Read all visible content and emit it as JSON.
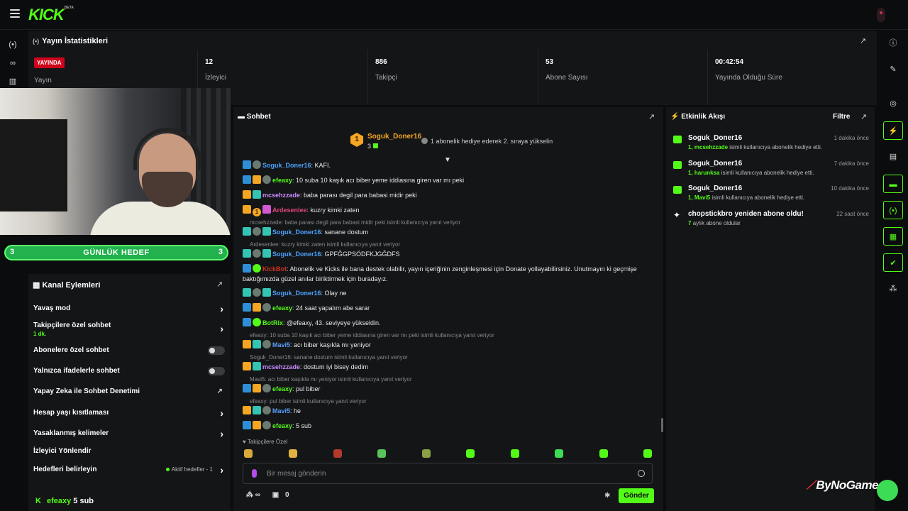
{
  "app": {
    "logo": "KICK",
    "logo_sup": "BETA"
  },
  "stats": {
    "title": "Yayın İstatistikleri",
    "live_badge": "YAYINDA",
    "live_label": "Yayın",
    "items": [
      {
        "value": "12",
        "label": "İzleyici"
      },
      {
        "value": "886",
        "label": "Takipçi"
      },
      {
        "value": "53",
        "label": "Abone Sayısı"
      },
      {
        "value": "00:42:54",
        "label": "Yayında Olduğu Süre"
      }
    ]
  },
  "goal": {
    "label": "GÜNLÜK HEDEF",
    "left": "3",
    "right": "3"
  },
  "actions": {
    "title": "Kanal Eylemleri",
    "rows": [
      {
        "label": "Yavaş mod",
        "sub": ""
      },
      {
        "label": "Takipçilere özel sohbet",
        "sub": "1 dk."
      },
      {
        "label": "Abonelere özel sohbet",
        "sub": ""
      },
      {
        "label": "Yalnızca ifadelerle sohbet",
        "sub": ""
      },
      {
        "label": "Yapay Zeka ile Sohbet Denetimi",
        "sub": ""
      },
      {
        "label": "Hesap yaşı kısıtlaması",
        "sub": ""
      },
      {
        "label": "Yasaklanmış kelimeler",
        "sub": ""
      },
      {
        "label": "İzleyici Yönlendir",
        "sub": ""
      },
      {
        "label": "Hedefleri belirleyin",
        "sub": ""
      }
    ],
    "goal_info": "Aktif hedefler - 1",
    "bottom_user": "efeaxy",
    "bottom_text": "5 sub"
  },
  "chat": {
    "title": "Sohbet",
    "pinned": {
      "rank": "1",
      "name": "Soguk_Doner16",
      "count": "3",
      "message": "1 abonelik hediye ederek 2. sıraya yükselin"
    },
    "messages": [
      {
        "user": "Soguk_Doner16",
        "text": ": KAFI."
      },
      {
        "user": "efeaxy",
        "text": ": 10 suba 10 kaşık acı biber yeme iddiasına giren var mı peki"
      },
      {
        "user": "mcsehzzade",
        "text": ": baba parası degil para babasi midir peki"
      },
      {
        "user": "Ardesenlee",
        "text": ": kuzry kimki zaten"
      },
      {
        "reply": "mcsehzzade: baba parası degil para babasi midir peki isimli kullanıcıya yanıt veriyor",
        "user": "Soguk_Doner16",
        "text": ": sanane dostum"
      },
      {
        "reply": "Ardesenlee: kuzry kimki zaten isimli kullanıcıya yanıt veriyor",
        "user": "Soguk_Doner16",
        "text": ": GPFĞGPSÖDFKJGĞDFS"
      },
      {
        "user": "KickBot",
        "text": ": Abonelik ve Kicks ile bana destek olabilir, yayın içeriğinin zenginleşmesi için Donate yollayabilirsiniz. Unutmayın ki geçmişe",
        "text2": "baktığımızda güzel anılar biriktirmek için buradayız."
      },
      {
        "user": "Soguk_Doner16",
        "text": ": Olay ne"
      },
      {
        "user": "efeaxy",
        "text": ": 24 saat yapalım abe sarar"
      },
      {
        "user": "BotRix",
        "text": ": @efeaxy, 43. seviyeye yükseldin."
      },
      {
        "reply": "efeaxy: 10 suba 10 kaşık acı biber yeme iddiasına giren var mı peki isimli kullanıcıya yanıt veriyor",
        "user": "Mavi5",
        "text": ": acı biber kaşıkla mı yeniyor"
      },
      {
        "reply": "Soguk_Doner16: sanane dostum isimli kullanıcıya yanıt veriyor",
        "user": "mcsehzzade",
        "text": ": dostum iyi bisey dedim"
      },
      {
        "reply": "Mavi5: acı biber kaşıkla mı yeniyor isimli kullanıcıya yanıt veriyor",
        "user": "efeaxy",
        "text": ": pul biber"
      },
      {
        "reply": "efeaxy: pul biber isimli kullanıcıya yanıt veriyor",
        "user": "Mavi5",
        "text": ": he"
      },
      {
        "user": "efeaxy",
        "text": ": 5 sub"
      }
    ],
    "emote_label": "Takipçilere Özel",
    "input_placeholder": "Bir mesaj gönderin",
    "kicks": "0",
    "send_label": "Gönder",
    "colors": {
      "efeaxy": "#53fc18",
      "Soguk_Doner16": "#4aa3ff",
      "mcsehzzade": "#c98bff",
      "Ardesenlee": "#e0457b",
      "KickBot": "#d0311b",
      "BotRix": "#53fc18",
      "Mavi5": "#5aa0ff"
    }
  },
  "feed": {
    "title": "Etkinlik Akışı",
    "filter": "Filtre",
    "items": [
      {
        "name": "Soguk_Doner16",
        "time": "1 dakika önce",
        "count": "1,",
        "target": "mcsehzzade",
        "desc": " isimli kullanıcıya abonelik hediye etti."
      },
      {
        "name": "Soguk_Doner16",
        "time": "7 dakika önce",
        "count": "1,",
        "target": "harunksa",
        "desc": " isimli kullanıcıya abonelik hediye etti."
      },
      {
        "name": "Soguk_Doner16",
        "time": "10 dakika önce",
        "count": "1,",
        "target": "Mavi5",
        "desc": " isimli kullanıcıya abonelik hediye etti."
      },
      {
        "name": "chopstickbro yeniden abone oldu!",
        "time": "22 saat önce",
        "count": "7",
        "target": "",
        "desc": " aylık abone oldular"
      }
    ]
  },
  "watermark": "ByNoGame"
}
